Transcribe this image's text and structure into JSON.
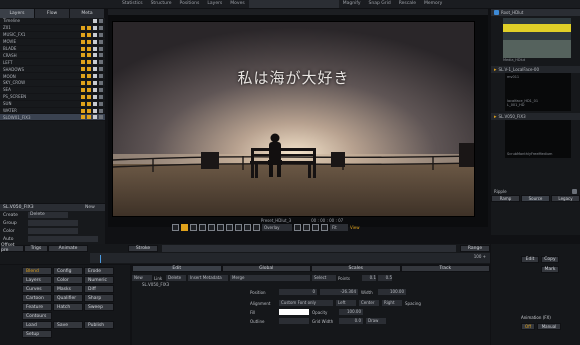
{
  "menu": [
    "Statistics",
    "Structure",
    "Positions",
    "Layers",
    "Moves",
    "Magnify",
    "Snap Grid",
    "Rescale",
    "Memory"
  ],
  "left_tabs": [
    "Layers",
    "Flow",
    "Meta"
  ],
  "layers": [
    {
      "name": "Timeline",
      "swatch": false
    },
    {
      "name": "Z01",
      "swatch": true
    },
    {
      "name": "MUSIC_FX1",
      "swatch": true
    },
    {
      "name": "MOVIE",
      "swatch": true
    },
    {
      "name": "BLADE",
      "swatch": true
    },
    {
      "name": "CRASH",
      "swatch": true
    },
    {
      "name": "LEFT",
      "swatch": true
    },
    {
      "name": "SHADOWS",
      "swatch": true
    },
    {
      "name": "MOON",
      "swatch": true
    },
    {
      "name": "SKY_CROW",
      "swatch": true
    },
    {
      "name": "SEA",
      "swatch": true
    },
    {
      "name": "PS_SCREEN",
      "swatch": true
    },
    {
      "name": "SUN",
      "swatch": true
    },
    {
      "name": "WATER",
      "swatch": true
    },
    {
      "name": "SLOW01_FIX3",
      "swatch": true
    }
  ],
  "left_lower": {
    "title": "SL.V050_FIX3",
    "new_label": "New",
    "rows": [
      {
        "label": "Create",
        "value": "Delete"
      },
      {
        "label": "Group",
        "value": ""
      },
      {
        "label": "Color",
        "value": ""
      },
      {
        "label": "Auto",
        "value": ""
      }
    ]
  },
  "viewer": {
    "overlay_text": "私は海が大好き",
    "clip_name": "Preset_HDlut_3",
    "timecode": "00 : 00 : 00 : 07",
    "display_label": "Overlay",
    "zoom_label": "Fit",
    "mode_label": "View"
  },
  "right_panel": {
    "top_title": "Root_HDlut",
    "thumb_caption": "Media_HDlut",
    "bin_title": "SL.V-1_LocalFace-00",
    "bin_items": [
      "mv011",
      "localface_HD1_01",
      "L_001_HD"
    ],
    "clip_title": "SL.V050_FIX3",
    "clip_caption": "ScrubMonthlyFreeMedium",
    "panel_label": "Ripple",
    "tabs": [
      "Ramp",
      "Source",
      "Legacy"
    ],
    "buttons": [
      "Edit",
      "Copy",
      "Mark"
    ],
    "lower_title": "Animation (FX)",
    "lower_items": [
      "Off",
      "Manual"
    ]
  },
  "timeline": {
    "tabs": [
      "Offset pre",
      "Trigs",
      "Animate"
    ],
    "stroke_label": "Stroke",
    "range_label": "Range",
    "ruler_value": "100 +"
  },
  "bottom_left": {
    "grid": [
      [
        "Blend",
        "Config",
        "Erode"
      ],
      [
        "Layers",
        "Color",
        "Numeric"
      ],
      [
        "Curves",
        "Masks",
        "Diff"
      ],
      [
        "Cartoon",
        "Qualifier",
        "Sharp"
      ],
      [
        "Feature",
        "Hatch",
        "Sweep"
      ],
      [
        "Contours",
        "",
        ""
      ],
      [
        "Load",
        "Save",
        "Publish"
      ],
      [
        "Setup",
        "",
        ""
      ]
    ]
  },
  "props_tabs": [
    "Edit",
    "Global",
    "Scales",
    "Track"
  ],
  "props": {
    "row1": [
      "New",
      "Link",
      "Delete",
      "Insert Metadata",
      "Merge",
      "Select",
      "Points",
      "0.1",
      "0.5"
    ],
    "row2_label": "SL.V050_FIX3",
    "position_label": "Position",
    "pos_x": "0",
    "pos_y": "-26.304",
    "width_label": "Width",
    "width_value": "100.00",
    "alignment_label": "Alignment",
    "alignment_value": "Custom Font only",
    "align_left": "Left",
    "align_center": "Center",
    "align_right": "Right",
    "spacing_label": "Spacing",
    "fill_label": "Fill",
    "opacity_label": "Opacity",
    "opacity_value": "100.00",
    "outline_label": "Outline",
    "grid_width_label": "Grid Width",
    "grid_width_value": "0.0",
    "draw_label": "Draw"
  }
}
